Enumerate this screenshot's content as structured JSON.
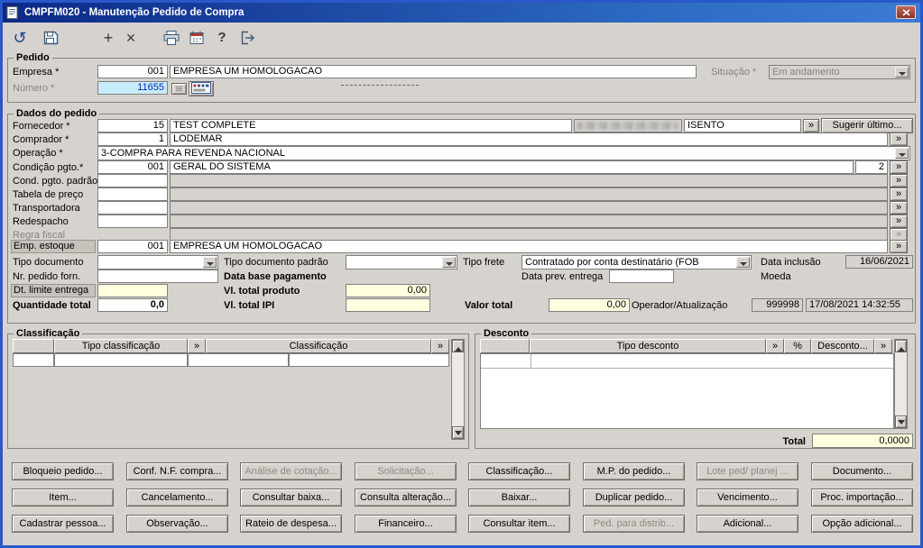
{
  "window": {
    "title": "CMPFM020 - Manutenção Pedido de Compra"
  },
  "toolbar": {
    "refresh_glyph": "↺",
    "add_glyph": "+",
    "delete_glyph": "×",
    "help_glyph": "?"
  },
  "symbols": {
    "lookup": "»"
  },
  "pedido": {
    "legend": "Pedido",
    "empresa_label": "Empresa *",
    "empresa_code": "001",
    "empresa_name": "EMPRESA UM HOMOLOGACAO",
    "situacao_label": "Situação *",
    "situacao_value": "Em andamento",
    "numero_label": "Número *",
    "numero_value": "11655"
  },
  "dados": {
    "legend": "Dados do pedido",
    "fornecedor_label": "Fornecedor *",
    "fornecedor_code": "15",
    "fornecedor_name": "TEST COMPLETE",
    "fornecedor_status": "ISENTO",
    "sugerir_button": "Sugerir último...",
    "comprador_label": "Comprador *",
    "comprador_code": "1",
    "comprador_name": "LODEMAR",
    "operacao_label": "Operação *",
    "operacao_value": "3-COMPRA PARA REVENDA NACIONAL",
    "condicao_label": "Condição pgto.*",
    "condicao_code": "001",
    "condicao_name": "GERAL DO SISTEMA",
    "condicao_parcelas": "2",
    "cond_padrao_label": "Cond. pgto. padrão",
    "tabela_label": "Tabela de preço",
    "transportadora_label": "Transportadora",
    "redespacho_label": "Redespacho",
    "regra_fiscal_label": "Regra fiscal",
    "emp_estoque_label": "Emp. estoque",
    "emp_estoque_code": "001",
    "emp_estoque_name": "EMPRESA UM HOMOLOGACAO",
    "tipo_documento_label": "Tipo documento",
    "tipo_doc_padrao_label": "Tipo documento padrão",
    "tipo_frete_label": "Tipo frete",
    "tipo_frete_value": "Contratado por conta destinatário (FOB",
    "data_inclusao_label": "Data inclusão",
    "data_inclusao_value": "16/06/2021",
    "nr_pedido_label": "Nr. pedido forn.",
    "data_base_label": "Data base pagamento",
    "data_prev_label": "Data prev. entrega",
    "moeda_label": "Moeda",
    "dt_limite_label": "Dt. limite entrega",
    "vl_produto_label": "Vl. total produto",
    "vl_produto_value": "0,00",
    "qtd_total_label": "Quantidade total",
    "qtd_total_value": "0,0",
    "vl_ipi_label": "Vl. total IPI",
    "vl_ipi_value": "",
    "valor_total_label": "Valor total",
    "valor_total_value": "0,00",
    "operador_label": "Operador/Atualização",
    "operador_code": "999998",
    "operador_data": "17/08/2021 14:32:55"
  },
  "classificacao": {
    "legend": "Classificação",
    "header_tipo": "Tipo classificação",
    "header_class": "Classificação"
  },
  "desconto": {
    "legend": "Desconto",
    "header_tipo": "Tipo desconto",
    "header_pct": "%",
    "header_desc": "Desconto...",
    "total_label": "Total",
    "total_value": "0,0000"
  },
  "buttons": {
    "rows": [
      [
        {
          "label": "Bloqueio pedido...",
          "enabled": true
        },
        {
          "label": "Conf. N.F. compra...",
          "enabled": true
        },
        {
          "label": "Análise de cotação...",
          "enabled": false
        },
        {
          "label": "Solicitação...",
          "enabled": false
        },
        {
          "label": "Classificação...",
          "enabled": true
        },
        {
          "label": "M.P. do pedido...",
          "enabled": true
        },
        {
          "label": "Lote ped/ planej ...",
          "enabled": false
        },
        {
          "label": "Documento...",
          "enabled": true
        }
      ],
      [
        {
          "label": "Item...",
          "enabled": true
        },
        {
          "label": "Cancelamento...",
          "enabled": true
        },
        {
          "label": "Consultar baixa...",
          "enabled": true
        },
        {
          "label": "Consulta alteração...",
          "enabled": true
        },
        {
          "label": "Baixar...",
          "enabled": true
        },
        {
          "label": "Duplicar pedido...",
          "enabled": true
        },
        {
          "label": "Vencimento...",
          "enabled": true
        },
        {
          "label": "Proc. importação...",
          "enabled": true
        }
      ],
      [
        {
          "label": "Cadastrar pessoa...",
          "enabled": true
        },
        {
          "label": "Observação...",
          "enabled": true
        },
        {
          "label": "Rateio de despesa...",
          "enabled": true
        },
        {
          "label": "Financeiro...",
          "enabled": true
        },
        {
          "label": "Consultar item...",
          "enabled": true
        },
        {
          "label": "Ped. para distrib...",
          "enabled": false
        },
        {
          "label": "Adicional...",
          "enabled": true
        },
        {
          "label": "Opção adicional...",
          "enabled": true
        }
      ]
    ]
  }
}
